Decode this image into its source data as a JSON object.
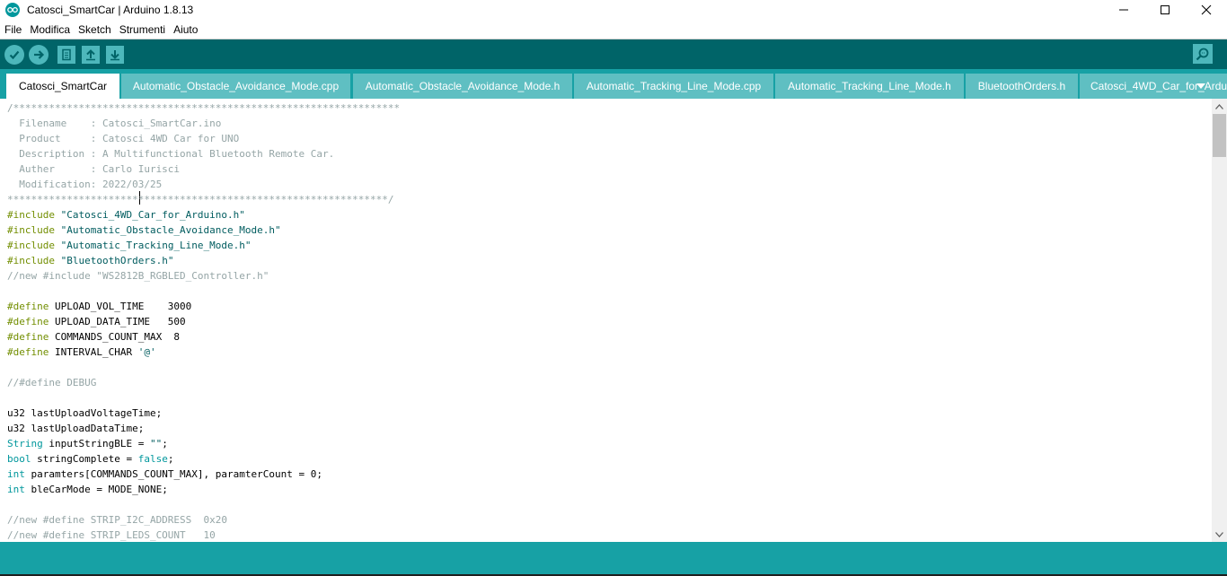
{
  "window": {
    "title": "Catosci_SmartCar | Arduino 1.8.13"
  },
  "menu": [
    "File",
    "Modifica",
    "Sketch",
    "Strumenti",
    "Aiuto"
  ],
  "toolbar": {
    "buttons": [
      "verify-icon",
      "upload-icon",
      "new-icon",
      "open-icon",
      "save-icon"
    ],
    "right_button": "serial-monitor-icon"
  },
  "tabs": [
    {
      "label": "Catosci_SmartCar",
      "active": true
    },
    {
      "label": "Automatic_Obstacle_Avoidance_Mode.cpp",
      "active": false
    },
    {
      "label": "Automatic_Obstacle_Avoidance_Mode.h",
      "active": false
    },
    {
      "label": "Automatic_Tracking_Line_Mode.cpp",
      "active": false
    },
    {
      "label": "Automatic_Tracking_Line_Mode.h",
      "active": false
    },
    {
      "label": "BluetoothOrders.h",
      "active": false
    },
    {
      "label": "Catosci_4WD_Car_for_Ardu",
      "active": false
    }
  ],
  "code": [
    [
      {
        "t": "/*****************************************************************",
        "c": "comment"
      }
    ],
    [
      {
        "t": "  Filename    : Catosci_SmartCar.ino",
        "c": "comment"
      }
    ],
    [
      {
        "t": "  Product     : Catosci 4WD Car for UNO",
        "c": "comment"
      }
    ],
    [
      {
        "t": "  Description : A Multifunctional Bluetooth Remote Car.",
        "c": "comment"
      }
    ],
    [
      {
        "t": "  Auther      : Carlo Iurisci",
        "c": "comment"
      }
    ],
    [
      {
        "t": "  Modification: 2022/03/25",
        "c": "comment"
      }
    ],
    [
      {
        "t": "****************************************************************/",
        "c": "comment"
      }
    ],
    [
      {
        "t": "#include",
        "c": "kw-orange"
      },
      {
        "t": " \"Catosci_4WD_Car_for_Arduino.h\"",
        "c": "str"
      }
    ],
    [
      {
        "t": "#include",
        "c": "kw-orange"
      },
      {
        "t": " \"Automatic_Obstacle_Avoidance_Mode.h\"",
        "c": "str"
      }
    ],
    [
      {
        "t": "#include",
        "c": "kw-orange"
      },
      {
        "t": " \"Automatic_Tracking_Line_Mode.h\"",
        "c": "str"
      }
    ],
    [
      {
        "t": "#include",
        "c": "kw-orange"
      },
      {
        "t": " \"BluetoothOrders.h\"",
        "c": "str"
      }
    ],
    [
      {
        "t": "//new #include \"WS2812B_RGBLED_Controller.h\"",
        "c": "comment"
      }
    ],
    [],
    [
      {
        "t": "#define",
        "c": "kw-orange"
      },
      {
        "t": " UPLOAD_VOL_TIME    3000",
        "c": ""
      }
    ],
    [
      {
        "t": "#define",
        "c": "kw-orange"
      },
      {
        "t": " UPLOAD_DATA_TIME   500",
        "c": ""
      }
    ],
    [
      {
        "t": "#define",
        "c": "kw-orange"
      },
      {
        "t": " COMMANDS_COUNT_MAX  8",
        "c": ""
      }
    ],
    [
      {
        "t": "#define",
        "c": "kw-orange"
      },
      {
        "t": " INTERVAL_CHAR ",
        "c": ""
      },
      {
        "t": "'@'",
        "c": "str"
      }
    ],
    [],
    [
      {
        "t": "//#define DEBUG",
        "c": "comment"
      }
    ],
    [],
    [
      {
        "t": "u32 lastUploadVoltageTime;",
        "c": ""
      }
    ],
    [
      {
        "t": "u32 lastUploadDataTime;",
        "c": ""
      }
    ],
    [
      {
        "t": "String",
        "c": "kw-blue"
      },
      {
        "t": " inputStringBLE = ",
        "c": ""
      },
      {
        "t": "\"\"",
        "c": "str"
      },
      {
        "t": ";",
        "c": ""
      }
    ],
    [
      {
        "t": "bool",
        "c": "kw-blue"
      },
      {
        "t": " stringComplete = ",
        "c": ""
      },
      {
        "t": "false",
        "c": "kw-blue"
      },
      {
        "t": ";",
        "c": ""
      }
    ],
    [
      {
        "t": "int",
        "c": "kw-blue"
      },
      {
        "t": " paramters[COMMANDS_COUNT_MAX], paramterCount = 0;",
        "c": ""
      }
    ],
    [
      {
        "t": "int",
        "c": "kw-blue"
      },
      {
        "t": " bleCarMode = MODE_NONE;",
        "c": ""
      }
    ],
    [],
    [
      {
        "t": "//new #define STRIP_I2C_ADDRESS  0x20",
        "c": "comment"
      }
    ],
    [
      {
        "t": "//new #define STRIP_LEDS_COUNT   10",
        "c": "comment"
      }
    ]
  ]
}
